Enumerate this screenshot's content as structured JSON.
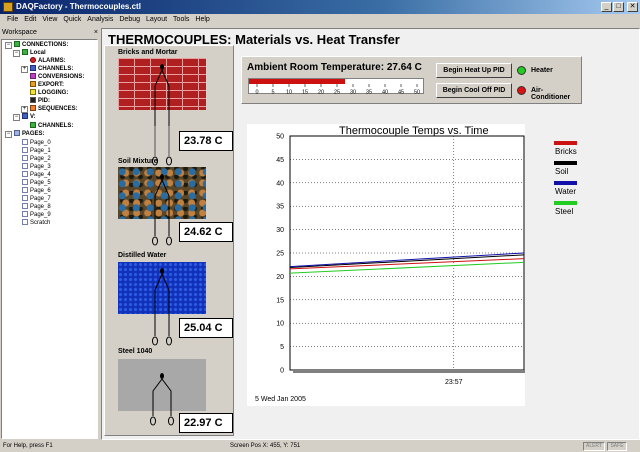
{
  "window": {
    "title": "DAQFactory - Thermocouples.ctl",
    "buttons": [
      "_",
      "□",
      "✕"
    ]
  },
  "menu": [
    "File",
    "Edit",
    "View",
    "Quick",
    "Analysis",
    "Debug",
    "Layout",
    "Tools",
    "Help"
  ],
  "workspace": {
    "header": "Workspace",
    "close": "×",
    "tree": [
      "CONNECTIONS:",
      "Local",
      "ALARMS:",
      "CHANNELS:",
      "CONVERSIONS:",
      "EXPORT:",
      "LOGGING:",
      "PID:",
      "SEQUENCES:",
      "V:",
      "CHANNELS:",
      "PAGES:",
      "Page_0",
      "Page_1",
      "Page_2",
      "Page_3",
      "Page_4",
      "Page_5",
      "Page_6",
      "Page_7",
      "Page_8",
      "Page_9",
      "Scratch"
    ]
  },
  "page": {
    "title": "THERMOCOUPLES: Materials vs. Heat Transfer"
  },
  "materials": [
    {
      "name": "Bricks and Mortar",
      "temp": "23.78 C"
    },
    {
      "name": "Soil Mixture",
      "temp": "24.62 C"
    },
    {
      "name": "Distilled Water",
      "temp": "25.04 C"
    },
    {
      "name": "Steel 1040",
      "temp": "22.97 C"
    }
  ],
  "controls": {
    "ambient_label": "Ambient Room Temperature:",
    "ambient_value": "27.64 C",
    "tank_level": 27.64,
    "tank_ticks": [
      "0",
      "5",
      "10",
      "15",
      "20",
      "25",
      "30",
      "35",
      "40",
      "45",
      "50"
    ],
    "heat_button": "Begin Heat Up PID",
    "cool_button": "Begin Cool Off PID",
    "heater_label": "Heater",
    "ac_label": "Air-Conditioner",
    "heater_color": "#22cc22",
    "ac_color": "#dd1111"
  },
  "chart_data": {
    "type": "line",
    "title": "Thermocouple Temps vs. Time",
    "ylim": [
      0,
      50
    ],
    "yticks": [
      "50",
      "45",
      "40",
      "35",
      "30",
      "25",
      "20",
      "15",
      "10",
      "5",
      "0"
    ],
    "xtick_label": "23:57",
    "date_label": "5 Wed Jan 2005",
    "grid": "dotted",
    "legend_position": "right",
    "series": [
      {
        "name": "Bricks",
        "color": "#cc1111",
        "y_start": 21.6,
        "y_end": 23.8
      },
      {
        "name": "Soil",
        "color": "#000000",
        "y_start": 21.9,
        "y_end": 24.6
      },
      {
        "name": "Water",
        "color": "#1111aa",
        "y_start": 22.1,
        "y_end": 25.0
      },
      {
        "name": "Steel",
        "color": "#22cc22",
        "y_start": 20.7,
        "y_end": 23.0
      }
    ]
  },
  "status": {
    "help": "For Help, press F1",
    "position": "Screen Pos X: 455, Y: 751",
    "alert": "ALERT",
    "safe": "SAFE"
  }
}
